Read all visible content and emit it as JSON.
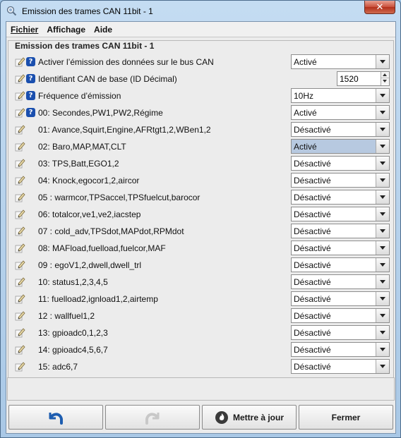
{
  "window": {
    "title": "Emission des trames CAN 11bit - 1",
    "close_glyph": "✕"
  },
  "menu": [
    {
      "label": "Fichier"
    },
    {
      "label": "Affichage"
    },
    {
      "label": "Aide"
    }
  ],
  "panel": {
    "title": "Emission des trames CAN 11bit - 1"
  },
  "rows": [
    {
      "label": "Activer l’émission des données sur le bus CAN",
      "help": true,
      "control": "combo",
      "value": "Activé"
    },
    {
      "label": "Identifiant CAN de base (ID Décimal)",
      "help": true,
      "control": "spinner",
      "value": "1520"
    },
    {
      "label": "Fréquence d’émission",
      "help": true,
      "control": "combo",
      "value": "10Hz"
    },
    {
      "label": "00: Secondes,PW1,PW2,Régime",
      "help": true,
      "control": "combo",
      "value": "Activé"
    },
    {
      "label": "01: Avance,Squirt,Engine,AFRtgt1,2,WBen1,2",
      "help": false,
      "control": "combo",
      "value": "Désactivé"
    },
    {
      "label": "02: Baro,MAP,MAT,CLT",
      "help": false,
      "control": "combo",
      "value": "Activé",
      "selected": true
    },
    {
      "label": "03: TPS,Batt,EGO1,2",
      "help": false,
      "control": "combo",
      "value": "Désactivé"
    },
    {
      "label": "04: Knock,egocor1,2,aircor",
      "help": false,
      "control": "combo",
      "value": "Désactivé"
    },
    {
      "label": "05 : warmcor,TPSaccel,TPSfuelcut,barocor",
      "help": false,
      "control": "combo",
      "value": "Désactivé"
    },
    {
      "label": "06: totalcor,ve1,ve2,iacstep",
      "help": false,
      "control": "combo",
      "value": "Désactivé"
    },
    {
      "label": "07 : cold_adv,TPSdot,MAPdot,RPMdot",
      "help": false,
      "control": "combo",
      "value": "Désactivé"
    },
    {
      "label": "08: MAFload,fuelload,fuelcor,MAF",
      "help": false,
      "control": "combo",
      "value": "Désactivé"
    },
    {
      "label": "09 : egoV1,2,dwell,dwell_trl",
      "help": false,
      "control": "combo",
      "value": "Désactivé"
    },
    {
      "label": "10: status1,2,3,4,5",
      "help": false,
      "control": "combo",
      "value": "Désactivé"
    },
    {
      "label": "11: fuelload2,ignload1,2,airtemp",
      "help": false,
      "control": "combo",
      "value": "Désactivé"
    },
    {
      "label": "12 : wallfuel1,2",
      "help": false,
      "control": "combo",
      "value": "Désactivé"
    },
    {
      "label": "13: gpioadc0,1,2,3",
      "help": false,
      "control": "combo",
      "value": "Désactivé"
    },
    {
      "label": "14: gpioadc4,5,6,7",
      "help": false,
      "control": "combo",
      "value": "Désactivé"
    },
    {
      "label": "15: adc6,7",
      "help": false,
      "control": "combo",
      "value": "Désactivé"
    }
  ],
  "buttons": {
    "undo_icon": "undo-arrow-icon",
    "redo_icon": "redo-arrow-icon",
    "update_label": "Mettre à jour",
    "close_label": "Fermer"
  },
  "colors": {
    "titlebar": "#b9d4ee",
    "help_icon": "#1a4fae",
    "selected_combo": "#b7c9e0",
    "close_button": "#c94f3a"
  }
}
